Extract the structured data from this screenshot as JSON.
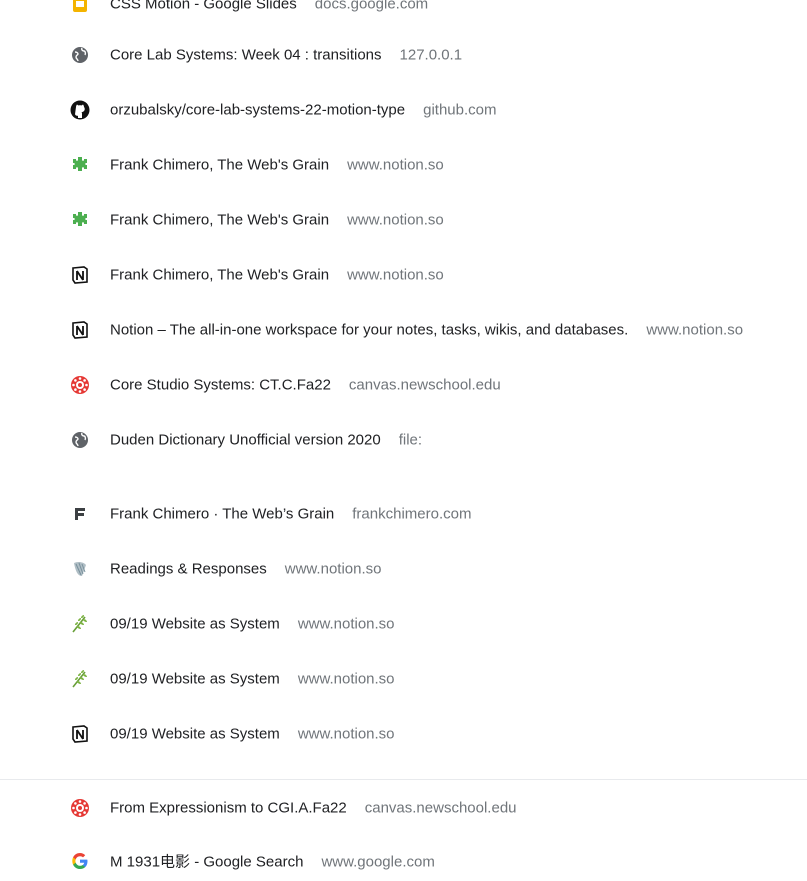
{
  "history": {
    "items": [
      {
        "icon": "google-slides-icon",
        "title": "CSS Motion - Google Slides",
        "domain": "docs.google.com"
      },
      {
        "icon": "globe-icon",
        "title": "Core Lab Systems: Week 04 : transitions",
        "domain": "127.0.0.1"
      },
      {
        "icon": "github-icon",
        "title": "orzubalsky/core-lab-systems-22-motion-type",
        "domain": "github.com"
      },
      {
        "icon": "puzzle-icon",
        "title": "Frank Chimero, The Web's Grain",
        "domain": "www.notion.so"
      },
      {
        "icon": "puzzle-icon",
        "title": "Frank Chimero, The Web's Grain",
        "domain": "www.notion.so"
      },
      {
        "icon": "notion-icon",
        "title": "Frank Chimero, The Web's Grain",
        "domain": "www.notion.so"
      },
      {
        "icon": "notion-icon",
        "title": "Notion – The all-in-one workspace for your notes, tasks, wikis, and databases.",
        "domain": "www.notion.so"
      },
      {
        "icon": "canvas-icon",
        "title": "Core Studio Systems: CT.C.Fa22",
        "domain": "canvas.newschool.edu"
      },
      {
        "icon": "globe-icon",
        "title": "Duden Dictionary Unofficial version 2020",
        "domain": "file:"
      },
      {
        "icon": "frankchimero-f-icon",
        "title": "Frank Chimero · The Web’s Grain",
        "domain": "frankchimero.com"
      },
      {
        "icon": "shell-icon",
        "title": "Readings & Responses",
        "domain": "www.notion.so"
      },
      {
        "icon": "leaf-icon",
        "title": "09/19 Website as System",
        "domain": "www.notion.so"
      },
      {
        "icon": "leaf-icon",
        "title": "09/19 Website as System",
        "domain": "www.notion.so"
      },
      {
        "icon": "notion-icon",
        "title": "09/19 Website as System",
        "domain": "www.notion.so"
      },
      {
        "icon": "canvas-icon",
        "title": "From Expressionism to CGI.A.Fa22",
        "domain": "canvas.newschool.edu"
      },
      {
        "icon": "google-g-icon",
        "title": "M 1931电影 - Google Search",
        "domain": "www.google.com"
      }
    ]
  },
  "colors": {
    "title": "#202124",
    "domain": "#70757a",
    "divider": "#e8eaed"
  }
}
